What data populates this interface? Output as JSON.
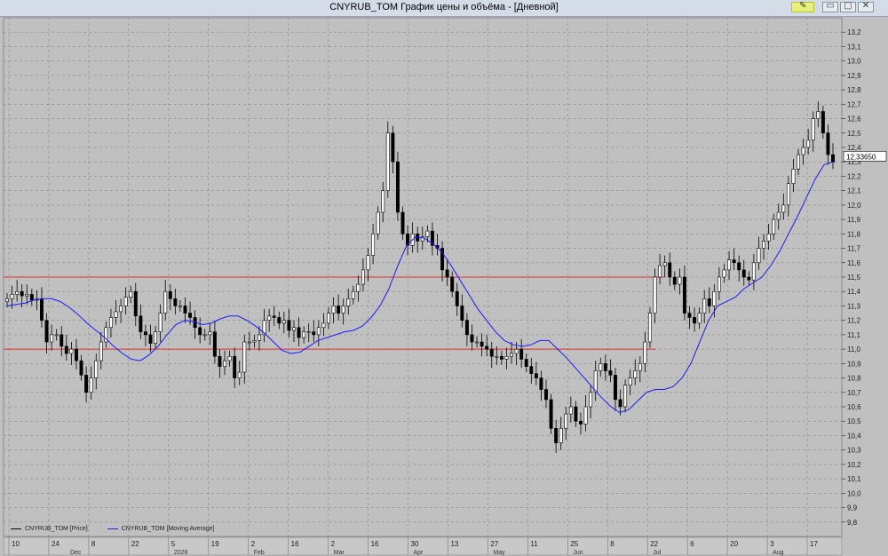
{
  "window": {
    "title": "CNYRUB_TOM График цены и объёма - [Дневной]",
    "pin_icon": "✎",
    "min_icon": "▭",
    "max_icon": "▢",
    "close_icon": "✕"
  },
  "chart_data": {
    "type": "line",
    "ylim": [
      9.7,
      13.3
    ],
    "y_ticks": [
      9.8,
      9.9,
      10.0,
      10.1,
      10.2,
      10.3,
      10.4,
      10.5,
      10.6,
      10.7,
      10.8,
      10.9,
      11.0,
      11.1,
      11.2,
      11.3,
      11.4,
      11.5,
      11.6,
      11.7,
      11.8,
      11.9,
      12.0,
      12.1,
      12.2,
      12.3,
      12.4,
      12.5,
      12.6,
      12.7,
      12.8,
      12.9,
      13.0,
      13.1,
      13.2
    ],
    "y_tick_labels": [
      "9,8",
      "9,9",
      "10,0",
      "10,1",
      "10,2",
      "10,3",
      "10,4",
      "10,5",
      "10,6",
      "10,7",
      "10,8",
      "10,9",
      "11,0",
      "11,1",
      "11,2",
      "11,3",
      "11,4",
      "11,5",
      "11,6",
      "11,7",
      "11,8",
      "11,9",
      "12,0",
      "12,1",
      "12,2",
      "12,3",
      "12,4",
      "12,5",
      "12,6",
      "12,7",
      "12,8",
      "12,9",
      "13,0",
      "13,1",
      "13,2"
    ],
    "last_price_label": "12,33650",
    "last_price": 12.3365,
    "horizontal_lines": [
      11.5,
      11.0
    ],
    "x_day_labels": [
      "10",
      "24",
      "8",
      "22",
      "5",
      "19",
      "2",
      "16",
      "2",
      "16",
      "30",
      "13",
      "27",
      "11",
      "25",
      "8",
      "22",
      "6",
      "20",
      "3",
      "17"
    ],
    "x_month_labels": [
      "Dec",
      "2026",
      "Feb",
      "Mar",
      "Apr",
      "May",
      "Jun",
      "Jul",
      "Aug"
    ],
    "legend": [
      {
        "label": "CNYRUB_TOM [Price]",
        "color": "#000000"
      },
      {
        "label": "CNYRUB_TOM [Moving Average]",
        "color": "#1a1aff"
      }
    ],
    "series": [
      {
        "name": "CNYRUB_TOM [Price]",
        "kind": "candlestick",
        "close": [
          11.35,
          11.38,
          11.4,
          11.37,
          11.38,
          11.34,
          11.35,
          11.2,
          11.05,
          11.1,
          11.1,
          11.02,
          10.97,
          11.0,
          10.92,
          10.82,
          10.7,
          10.8,
          10.92,
          11.05,
          11.15,
          11.22,
          11.26,
          11.3,
          11.36,
          11.4,
          11.23,
          11.12,
          11.1,
          11.04,
          11.12,
          11.25,
          11.4,
          11.35,
          11.3,
          11.3,
          11.25,
          11.22,
          11.15,
          11.1,
          11.1,
          11.12,
          10.95,
          10.88,
          10.92,
          10.95,
          10.8,
          10.84,
          11.05,
          11.05,
          11.06,
          11.1,
          11.2,
          11.23,
          11.22,
          11.18,
          11.2,
          11.13,
          11.15,
          11.08,
          11.12,
          11.12,
          11.1,
          11.15,
          11.18,
          11.25,
          11.3,
          11.25,
          11.3,
          11.35,
          11.4,
          11.45,
          11.55,
          11.65,
          11.8,
          11.95,
          12.1,
          12.5,
          12.3,
          11.95,
          11.8,
          11.72,
          11.8,
          11.75,
          11.78,
          11.82,
          11.72,
          11.7,
          11.55,
          11.5,
          11.4,
          11.3,
          11.2,
          11.1,
          11.05,
          11.05,
          11.02,
          11.0,
          10.95,
          10.95,
          10.93,
          10.95,
          10.97,
          11.0,
          10.93,
          10.88,
          10.83,
          10.8,
          10.72,
          10.65,
          10.45,
          10.35,
          10.45,
          10.55,
          10.6,
          10.5,
          10.48,
          10.6,
          10.7,
          10.85,
          10.9,
          10.85,
          10.82,
          10.65,
          10.6,
          10.75,
          10.8,
          10.85,
          10.9,
          11.05,
          11.25,
          11.5,
          11.58,
          11.6,
          11.5,
          11.45,
          11.5,
          11.25,
          11.22,
          11.18,
          11.25,
          11.35,
          11.3,
          11.4,
          11.5,
          11.55,
          11.62,
          11.6,
          11.55,
          11.5,
          11.48,
          11.6,
          11.7,
          11.75,
          11.8,
          11.9,
          11.95,
          12.0,
          12.15,
          12.25,
          12.35,
          12.4,
          12.45,
          12.6,
          12.65,
          12.5,
          12.35,
          12.3
        ]
      },
      {
        "name": "CNYRUB_TOM [Moving Average]",
        "kind": "line",
        "x_start_frac": 0.0,
        "values": [
          11.3,
          11.31,
          11.32,
          11.34,
          11.35,
          11.35,
          11.33,
          11.29,
          11.24,
          11.18,
          11.13,
          11.08,
          11.02,
          10.97,
          10.93,
          10.92,
          10.96,
          11.02,
          11.1,
          11.17,
          11.2,
          11.19,
          11.17,
          11.18,
          11.21,
          11.23,
          11.23,
          11.2,
          11.16,
          11.11,
          11.05,
          10.99,
          10.97,
          10.98,
          11.02,
          11.06,
          11.08,
          11.1,
          11.12,
          11.13,
          11.16,
          11.22,
          11.3,
          11.42,
          11.58,
          11.72,
          11.78,
          11.77,
          11.73,
          11.67,
          11.58,
          11.48,
          11.38,
          11.28,
          11.2,
          11.12,
          11.06,
          11.03,
          11.02,
          11.03,
          11.06,
          11.06,
          11.0,
          10.94,
          10.87,
          10.8,
          10.73,
          10.66,
          10.6,
          10.56,
          10.58,
          10.64,
          10.7,
          10.72,
          10.72,
          10.74,
          10.8,
          10.9,
          11.05,
          11.2,
          11.3,
          11.33,
          11.36,
          11.42,
          11.46,
          11.5,
          11.58,
          11.68,
          11.8,
          11.92,
          12.05,
          12.18,
          12.28,
          12.3
        ]
      }
    ]
  }
}
